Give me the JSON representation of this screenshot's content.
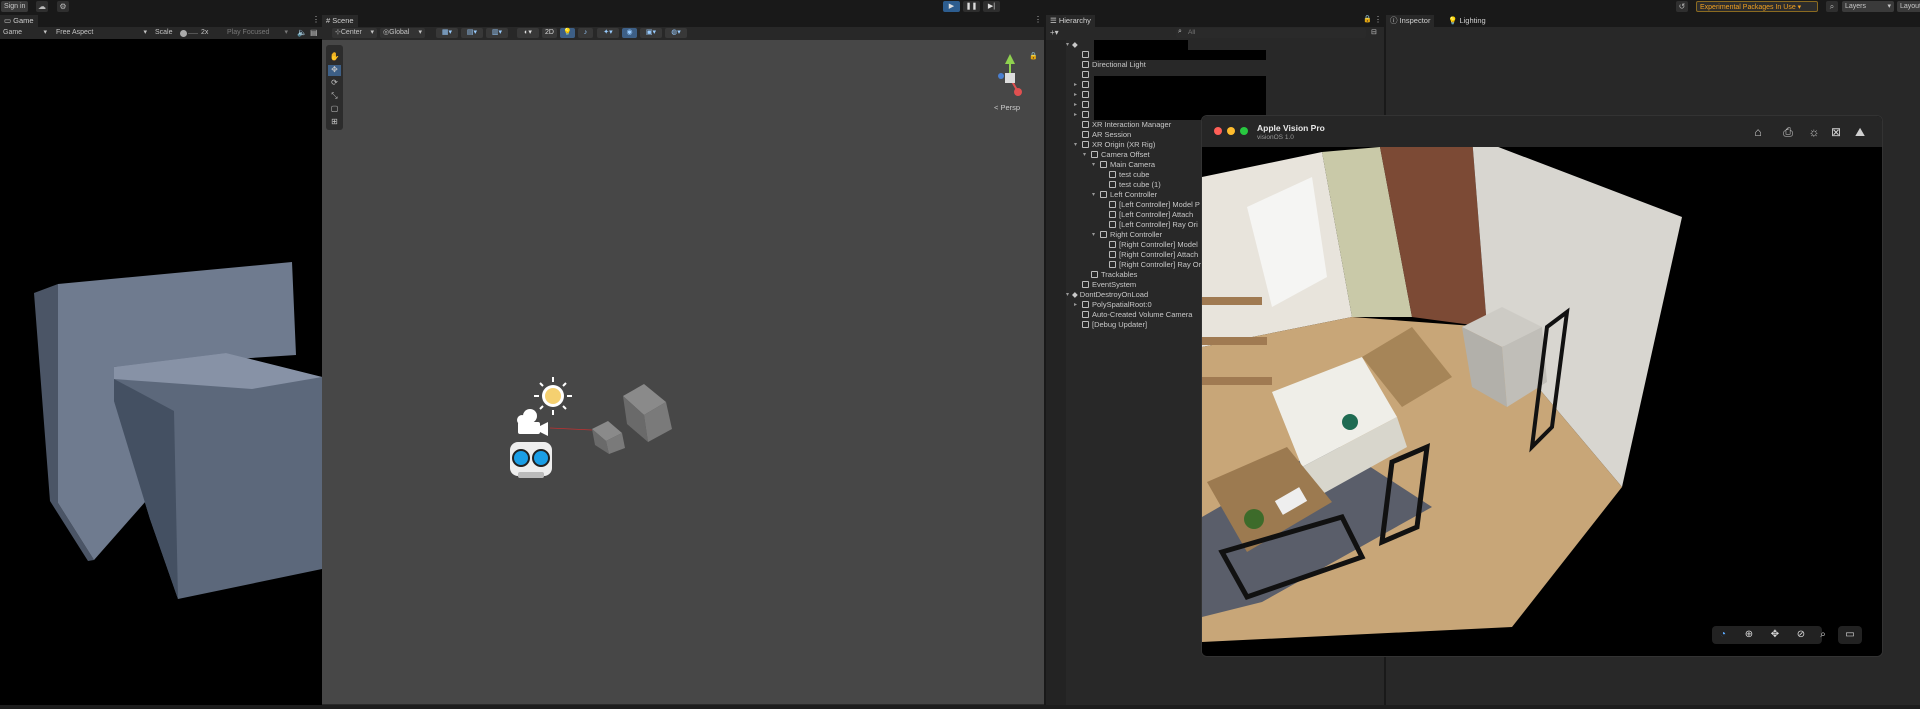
{
  "topbar": {
    "sign_in": "Sign in",
    "cloud_icon": "cloud-icon",
    "settings_icon": "gear-icon",
    "play_icon": "▶",
    "pause_icon": "❚❚",
    "step_icon": "▶|",
    "history_icon": "history-icon",
    "experimental": "Experimental Packages In Use ▾",
    "search_icon": "search-icon",
    "layers": "Layers",
    "layout": "Layout"
  },
  "game": {
    "tab": "Game",
    "display": "Game",
    "aspect": "Free Aspect",
    "scale_label": "Scale",
    "scale_value": "2x",
    "play_focused": "Play Focused"
  },
  "scene": {
    "tab": "Scene",
    "pivot": "Center",
    "space": "Global",
    "persp_label": "< Persp",
    "mode_2d": "2D"
  },
  "hierarchy": {
    "tab": "Hierarchy",
    "search_placeholder": "All",
    "rows": [
      {
        "label": "Directional Light"
      },
      {
        "label": "XR Interaction Manager"
      },
      {
        "label": "AR Session"
      },
      {
        "label": "XR Origin (XR Rig)"
      },
      {
        "label": "Camera Offset"
      },
      {
        "label": "Main Camera"
      },
      {
        "label": "test cube"
      },
      {
        "label": "test cube (1)"
      },
      {
        "label": "Left Controller"
      },
      {
        "label": "[Left Controller] Model P"
      },
      {
        "label": "[Left Controller] Attach"
      },
      {
        "label": "[Left Controller] Ray Ori"
      },
      {
        "label": "Right Controller"
      },
      {
        "label": "[Right Controller] Model"
      },
      {
        "label": "[Right Controller] Attach"
      },
      {
        "label": "[Right Controller] Ray Or"
      },
      {
        "label": "Trackables"
      },
      {
        "label": "EventSystem"
      },
      {
        "label": "DontDestroyOnLoad"
      },
      {
        "label": "PolySpatialRoot:0"
      },
      {
        "label": "Auto-Created Volume Camera"
      },
      {
        "label": "[Debug Updater]"
      }
    ]
  },
  "inspector": {
    "tab": "Inspector",
    "lighting_tab": "Lighting"
  },
  "vision_pro": {
    "title": "Apple Vision Pro",
    "subtitle": "visionOS 1.0"
  }
}
